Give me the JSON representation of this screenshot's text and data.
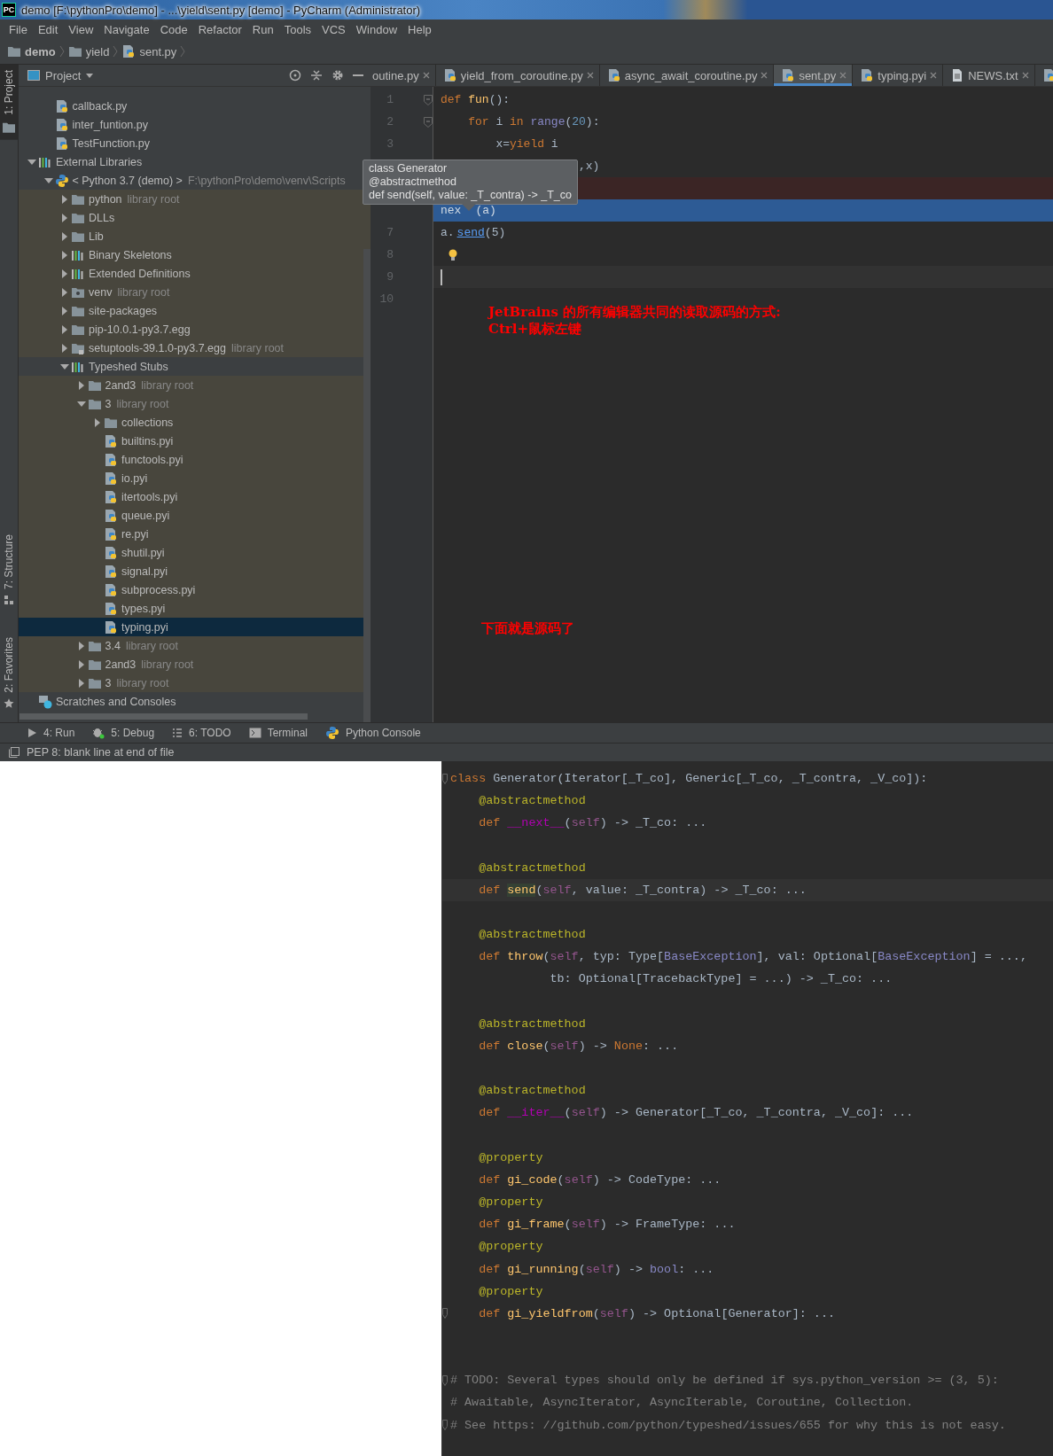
{
  "window": {
    "logo": "PC",
    "title": "demo [F:\\pythonPro\\demo] - ...\\yield\\sent.py [demo] - PyCharm (Administrator)"
  },
  "menu": [
    "File",
    "Edit",
    "View",
    "Navigate",
    "Code",
    "Refactor",
    "Run",
    "Tools",
    "VCS",
    "Window",
    "Help"
  ],
  "breadcrumbs": [
    {
      "label": "demo",
      "kind": "folder"
    },
    {
      "label": "yield",
      "kind": "folder"
    },
    {
      "label": "sent.py",
      "kind": "py"
    }
  ],
  "stripe": [
    {
      "label": "1: Project",
      "kind": "folder",
      "selected": true
    },
    {
      "label": "7: Structure",
      "kind": "structure",
      "selected": false
    },
    {
      "label": "2: Favorites",
      "kind": "star",
      "selected": false
    }
  ],
  "project_panel": {
    "title": "Project",
    "project_files": [
      {
        "label": "callback.py",
        "kind": "py",
        "tinted": false,
        "selected": false
      },
      {
        "label": "inter_funtion.py",
        "kind": "py",
        "tinted": false,
        "selected": false
      },
      {
        "label": "TestFunction.py",
        "kind": "py",
        "tinted": false,
        "selected": false
      }
    ],
    "tree": [
      {
        "label": "External Libraries",
        "kind": "lib",
        "expanded": true,
        "tinted": false,
        "selected": false,
        "children": [
          {
            "label": "< Python 3.7 (demo) >",
            "suffix": "F:\\pythonPro\\demo\\venv\\Scripts",
            "kind": "python",
            "expanded": true,
            "tinted": false,
            "selected": false,
            "children": [
              {
                "label": "python",
                "suffix": "library root",
                "kind": "folder",
                "expanded": false,
                "tinted": true,
                "selected": false
              },
              {
                "label": "DLLs",
                "kind": "folder",
                "expanded": false,
                "tinted": true,
                "selected": false
              },
              {
                "label": "Lib",
                "kind": "folder",
                "expanded": false,
                "tinted": true,
                "selected": false
              },
              {
                "label": "Binary Skeletons",
                "kind": "lib",
                "expanded": false,
                "tinted": true,
                "selected": false
              },
              {
                "label": "Extended Definitions",
                "kind": "lib",
                "expanded": false,
                "tinted": true,
                "selected": false
              },
              {
                "label": "venv",
                "suffix": "library root",
                "kind": "venv",
                "expanded": false,
                "tinted": true,
                "selected": false
              },
              {
                "label": "site-packages",
                "kind": "folder",
                "expanded": false,
                "tinted": true,
                "selected": false
              },
              {
                "label": "pip-10.0.1-py3.7.egg",
                "kind": "folder",
                "expanded": false,
                "tinted": true,
                "selected": false
              },
              {
                "label": "setuptools-39.1.0-py3.7.egg",
                "suffix": "library root",
                "kind": "locked",
                "expanded": false,
                "tinted": true,
                "selected": false
              },
              {
                "label": "Typeshed Stubs",
                "kind": "lib",
                "expanded": true,
                "tinted": false,
                "selected": false,
                "children": [
                  {
                    "label": "2and3",
                    "suffix": "library root",
                    "kind": "folder",
                    "expanded": false,
                    "tinted": true,
                    "selected": false
                  },
                  {
                    "label": "3",
                    "suffix": "library root",
                    "kind": "folder",
                    "expanded": true,
                    "tinted": true,
                    "selected": false,
                    "children": [
                      {
                        "label": "collections",
                        "kind": "folder",
                        "expanded": false,
                        "tinted": true,
                        "selected": false
                      },
                      {
                        "label": "builtins.pyi",
                        "kind": "py",
                        "tinted": true,
                        "selected": false
                      },
                      {
                        "label": "functools.pyi",
                        "kind": "py",
                        "tinted": true,
                        "selected": false
                      },
                      {
                        "label": "io.pyi",
                        "kind": "py",
                        "tinted": true,
                        "selected": false
                      },
                      {
                        "label": "itertools.pyi",
                        "kind": "py",
                        "tinted": true,
                        "selected": false
                      },
                      {
                        "label": "queue.pyi",
                        "kind": "py",
                        "tinted": true,
                        "selected": false
                      },
                      {
                        "label": "re.pyi",
                        "kind": "py",
                        "tinted": true,
                        "selected": false
                      },
                      {
                        "label": "shutil.pyi",
                        "kind": "py",
                        "tinted": true,
                        "selected": false
                      },
                      {
                        "label": "signal.pyi",
                        "kind": "py",
                        "tinted": true,
                        "selected": false
                      },
                      {
                        "label": "subprocess.pyi",
                        "kind": "py",
                        "tinted": true,
                        "selected": false
                      },
                      {
                        "label": "types.pyi",
                        "kind": "py",
                        "tinted": true,
                        "selected": false
                      },
                      {
                        "label": "typing.pyi",
                        "kind": "py",
                        "tinted": true,
                        "selected": true
                      }
                    ]
                  },
                  {
                    "label": "3.4",
                    "suffix": "library root",
                    "kind": "folder",
                    "expanded": false,
                    "tinted": true,
                    "selected": false
                  },
                  {
                    "label": "2and3",
                    "suffix": "library root",
                    "kind": "folder",
                    "expanded": false,
                    "tinted": true,
                    "selected": false
                  },
                  {
                    "label": "3",
                    "suffix": "library root",
                    "kind": "folder",
                    "expanded": false,
                    "tinted": true,
                    "selected": false
                  }
                ]
              }
            ]
          }
        ]
      },
      {
        "label": "Scratches and Consoles",
        "kind": "scratch",
        "tinted": false,
        "selected": false
      }
    ]
  },
  "tabs": [
    {
      "label": "outine.py",
      "selected": false
    },
    {
      "label": "yield_from_coroutine.py",
      "kind": "py",
      "selected": false
    },
    {
      "label": "async_await_coroutine.py",
      "kind": "py",
      "selected": false
    },
    {
      "label": "sent.py",
      "kind": "py",
      "selected": true
    },
    {
      "label": "typing.pyi",
      "kind": "py",
      "selected": false
    },
    {
      "label": "NEWS.txt",
      "kind": "txt",
      "selected": false
    },
    {
      "kind": "py",
      "selected": false
    }
  ],
  "editor": {
    "lines": [
      {
        "number": "1",
        "kind": "fold",
        "tokens": [
          {
            "text": "def",
            "kind": "kw"
          },
          {
            "text": " fun",
            "kind": "fn"
          },
          {
            "text": "():",
            "kind": "p"
          }
        ]
      },
      {
        "number": "2",
        "kind": "fold",
        "tokens": [
          {
            "text": "    for",
            "kind": "kw"
          },
          {
            "text": " i ",
            "kind": "p"
          },
          {
            "text": "in",
            "kind": "kw"
          },
          {
            "text": " range",
            "kind": "builtin"
          },
          {
            "text": "(",
            "kind": "p"
          },
          {
            "text": "20",
            "kind": "num"
          },
          {
            "text": "):",
            "kind": "p"
          }
        ]
      },
      {
        "number": "3",
        "kind": "plain",
        "tokens": [
          {
            "text": "        x=",
            "kind": "p"
          },
          {
            "text": "yield",
            "kind": "kw"
          },
          {
            "text": " i",
            "kind": "p"
          }
        ]
      },
      {
        "kind": "shifted",
        "tokens": [
          {
            "text": ",x)",
            "kind": "p"
          }
        ]
      },
      {
        "kind": "error"
      },
      {
        "kind": "selected",
        "tokens": [
          {
            "text": "nex",
            "kind": "p"
          },
          {
            "text": "(a)",
            "kind": "p"
          }
        ]
      },
      {
        "number": "7",
        "kind": "plain",
        "tokens": [
          {
            "text": "a.",
            "kind": "p"
          },
          {
            "text": "send",
            "kind": "link"
          },
          {
            "text": "(5)",
            "kind": "p"
          }
        ]
      },
      {
        "number": "8",
        "kind": "bulb"
      },
      {
        "number": "9",
        "kind": "cursor"
      },
      {
        "number": "10",
        "kind": "blank"
      }
    ],
    "tooltip": [
      "class Generator",
      "@abstractmethod",
      "def send(self, value: _T_contra) -> _T_co"
    ],
    "annotations": [
      {
        "lines": [
          "JetBrains 的所有编辑器共同的读取源码的方式:",
          "Ctrl+鼠标左键"
        ]
      },
      {
        "lines": [
          "下面就是源码了"
        ]
      }
    ]
  },
  "tool_windows": [
    {
      "label": "4: Run",
      "kind": "run"
    },
    {
      "label": "5: Debug",
      "kind": "debug"
    },
    {
      "label": "6: TODO",
      "kind": "todo"
    },
    {
      "label": "Terminal",
      "kind": "terminal"
    },
    {
      "label": "Python Console",
      "kind": "python"
    }
  ],
  "status_bar": "PEP 8: blank line at end of file",
  "source": {
    "lines": [
      {
        "kind": "fold",
        "tokens": [
          {
            "text": "class",
            "kind": "kw"
          },
          {
            "text": " Generator(Iterator[_T_co], Generic[_T_co, _T_contra, _V_co]):",
            "kind": "p"
          }
        ]
      },
      {
        "kind": "plain",
        "tokens": [
          {
            "text": "    @abstractmethod",
            "kind": "deco"
          }
        ]
      },
      {
        "kind": "plain",
        "tokens": [
          {
            "text": "    def",
            "kind": "kw"
          },
          {
            "text": " __next__",
            "kind": "magic"
          },
          {
            "text": "(",
            "kind": "p"
          },
          {
            "text": "self",
            "kind": "self"
          },
          {
            "text": ") -> _T_co: ...",
            "kind": "p"
          }
        ]
      },
      {
        "kind": "blank"
      },
      {
        "kind": "plain",
        "tokens": [
          {
            "text": "    @abstractmethod",
            "kind": "deco"
          }
        ]
      },
      {
        "kind": "current",
        "tokens": [
          {
            "text": "    def ",
            "kind": "kw"
          },
          {
            "text": "send",
            "kind": "hl"
          },
          {
            "text": "(",
            "kind": "p"
          },
          {
            "text": "self",
            "kind": "self"
          },
          {
            "text": ", value: _T_contra) -> _T_co: ...",
            "kind": "p"
          }
        ]
      },
      {
        "kind": "blank"
      },
      {
        "kind": "plain",
        "tokens": [
          {
            "text": "    @abstractmethod",
            "kind": "deco"
          }
        ]
      },
      {
        "kind": "plain",
        "tokens": [
          {
            "text": "    def",
            "kind": "kw"
          },
          {
            "text": " throw",
            "kind": "fn"
          },
          {
            "text": "(",
            "kind": "p"
          },
          {
            "text": "self",
            "kind": "self"
          },
          {
            "text": ", typ: Type[",
            "kind": "p"
          },
          {
            "text": "BaseException",
            "kind": "builtin"
          },
          {
            "text": "], val: Optional[",
            "kind": "p"
          },
          {
            "text": "BaseException",
            "kind": "builtin"
          },
          {
            "text": "] = ...,",
            "kind": "p"
          }
        ]
      },
      {
        "kind": "plain",
        "tokens": [
          {
            "text": "              tb: Optional[TracebackType] = ...) -> _T_co: ...",
            "kind": "p"
          }
        ]
      },
      {
        "kind": "blank"
      },
      {
        "kind": "plain",
        "tokens": [
          {
            "text": "    @abstractmethod",
            "kind": "deco"
          }
        ]
      },
      {
        "kind": "plain",
        "tokens": [
          {
            "text": "    def",
            "kind": "kw"
          },
          {
            "text": " close",
            "kind": "fn"
          },
          {
            "text": "(",
            "kind": "p"
          },
          {
            "text": "self",
            "kind": "self"
          },
          {
            "text": ") -> ",
            "kind": "p"
          },
          {
            "text": "None",
            "kind": "kw"
          },
          {
            "text": ": ...",
            "kind": "p"
          }
        ]
      },
      {
        "kind": "blank"
      },
      {
        "kind": "plain",
        "tokens": [
          {
            "text": "    @abstractmethod",
            "kind": "deco"
          }
        ]
      },
      {
        "kind": "plain",
        "tokens": [
          {
            "text": "    def",
            "kind": "kw"
          },
          {
            "text": " __iter__",
            "kind": "magic"
          },
          {
            "text": "(",
            "kind": "p"
          },
          {
            "text": "self",
            "kind": "self"
          },
          {
            "text": ") -> Generator[_T_co, _T_contra, _V_co]: ...",
            "kind": "p"
          }
        ]
      },
      {
        "kind": "blank"
      },
      {
        "kind": "plain",
        "tokens": [
          {
            "text": "    @property",
            "kind": "deco"
          }
        ]
      },
      {
        "kind": "plain",
        "tokens": [
          {
            "text": "    def",
            "kind": "kw"
          },
          {
            "text": " gi_code",
            "kind": "fn"
          },
          {
            "text": "(",
            "kind": "p"
          },
          {
            "text": "self",
            "kind": "self"
          },
          {
            "text": ") -> CodeType: ...",
            "kind": "p"
          }
        ]
      },
      {
        "kind": "plain",
        "tokens": [
          {
            "text": "    @property",
            "kind": "deco"
          }
        ]
      },
      {
        "kind": "plain",
        "tokens": [
          {
            "text": "    def",
            "kind": "kw"
          },
          {
            "text": " gi_frame",
            "kind": "fn"
          },
          {
            "text": "(",
            "kind": "p"
          },
          {
            "text": "self",
            "kind": "self"
          },
          {
            "text": ") -> FrameType: ...",
            "kind": "p"
          }
        ]
      },
      {
        "kind": "plain",
        "tokens": [
          {
            "text": "    @property",
            "kind": "deco"
          }
        ]
      },
      {
        "kind": "plain",
        "tokens": [
          {
            "text": "    def",
            "kind": "kw"
          },
          {
            "text": " gi_running",
            "kind": "fn"
          },
          {
            "text": "(",
            "kind": "p"
          },
          {
            "text": "self",
            "kind": "self"
          },
          {
            "text": ") -> ",
            "kind": "p"
          },
          {
            "text": "bool",
            "kind": "builtin"
          },
          {
            "text": ": ...",
            "kind": "p"
          }
        ]
      },
      {
        "kind": "plain",
        "tokens": [
          {
            "text": "    @property",
            "kind": "deco"
          }
        ]
      },
      {
        "kind": "fold",
        "tokens": [
          {
            "text": "    def",
            "kind": "kw"
          },
          {
            "text": " gi_yieldfrom",
            "kind": "fn"
          },
          {
            "text": "(",
            "kind": "p"
          },
          {
            "text": "self",
            "kind": "self"
          },
          {
            "text": ") -> Optional[Generator]: ...",
            "kind": "p"
          }
        ]
      },
      {
        "kind": "blank"
      },
      {
        "kind": "blank"
      },
      {
        "kind": "fold",
        "tokens": [
          {
            "text": "# TODO: Several types should only be defined if sys.python_version >= (3, 5):",
            "kind": "cmt"
          }
        ]
      },
      {
        "kind": "plain",
        "tokens": [
          {
            "text": "# Awaitable, AsyncIterator, AsyncIterable, Coroutine, Collection.",
            "kind": "cmt"
          }
        ]
      },
      {
        "kind": "fold",
        "tokens": [
          {
            "text": "# See https: //github.com/python/typeshed/issues/655 for why this is not easy.",
            "kind": "cmt"
          }
        ]
      }
    ]
  }
}
